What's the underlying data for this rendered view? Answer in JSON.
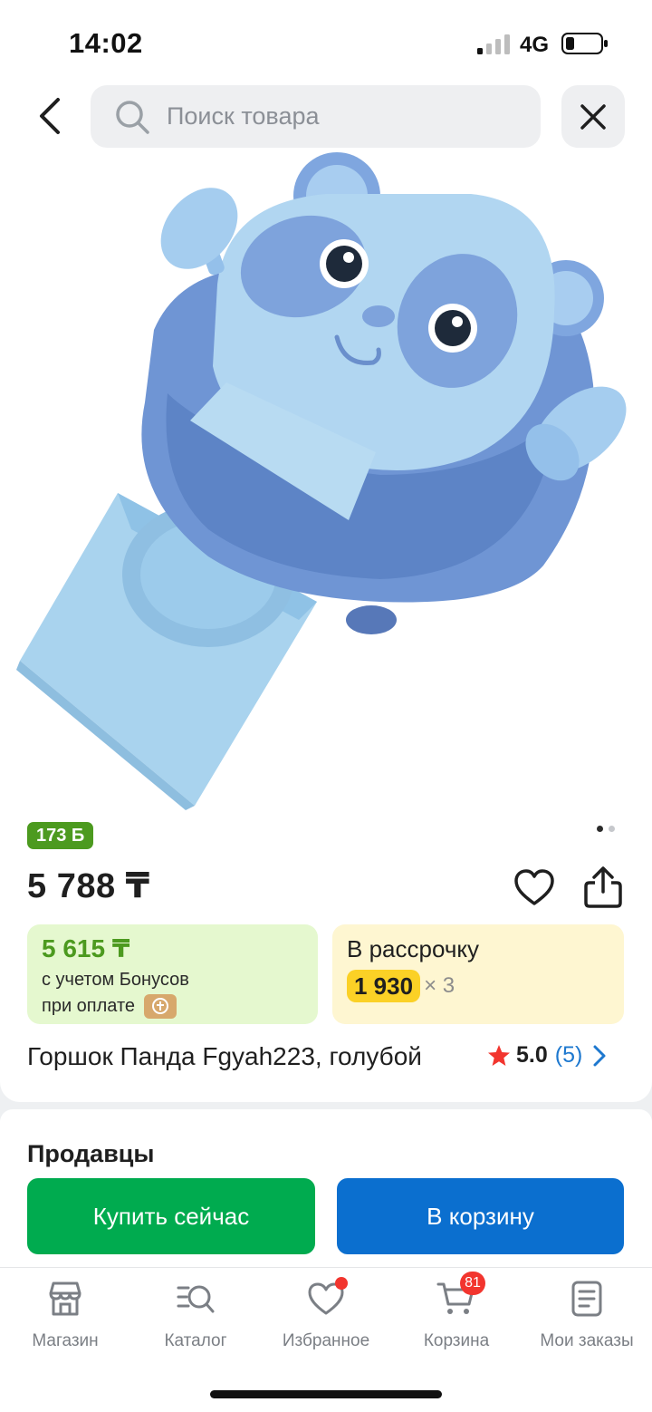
{
  "status_bar": {
    "time": "14:02",
    "network": "4G"
  },
  "search": {
    "placeholder": "Поиск товара"
  },
  "product": {
    "bonus_badge": "173 Б",
    "price": "5 788 ₸",
    "bonus_price": {
      "value": "5 615 ₸",
      "line1": "с учетом Бонусов",
      "line2": "при оплате"
    },
    "installment": {
      "label": "В рассрочку",
      "amount": "1 930",
      "multiplier": "× 3"
    },
    "title": "Горшок Панда Fgyah223, голубой",
    "rating": {
      "value": "5.0",
      "count": "(5)"
    },
    "image_pager": {
      "current": 1,
      "total": 2
    }
  },
  "sellers": {
    "heading": "Продавцы"
  },
  "actions": {
    "buy_now": "Купить сейчас",
    "add_to_cart": "В корзину"
  },
  "bottom_nav": {
    "items": [
      {
        "label": "Магазин",
        "icon": "store-icon"
      },
      {
        "label": "Каталог",
        "icon": "catalog-search-icon"
      },
      {
        "label": "Избранное",
        "icon": "heart-icon"
      },
      {
        "label": "Корзина",
        "icon": "cart-icon",
        "badge": "81"
      },
      {
        "label": "Мои заказы",
        "icon": "orders-icon"
      }
    ]
  },
  "colors": {
    "bonus_green": "#4c9a1f",
    "buy_green": "#00ab4f",
    "cart_blue": "#0b6fcf",
    "installment_yellow": "#fbd126",
    "badge_red": "#f2352e",
    "link_blue": "#1d78cf"
  }
}
